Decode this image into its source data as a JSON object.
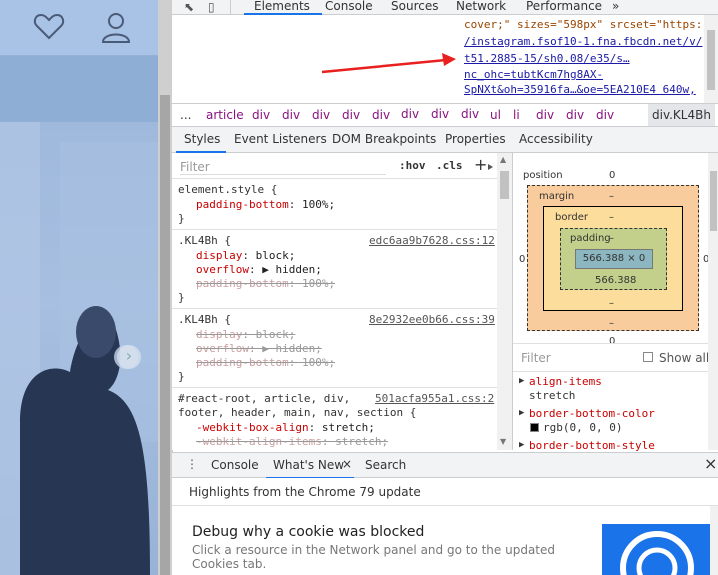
{
  "devtools_tabs": [
    "Elements",
    "Console",
    "Sources",
    "Network",
    "Performance",
    "»"
  ],
  "elements_code": [
    "cover;\" sizes=\"598px\" srcset=\"https:",
    "/instagram.fsof10-1.fna.fbcdn.net/v/",
    "t51.2885-15/sh0.08/e35/s…",
    "nc_ohc=tubtKcm7hg8AX-",
    "SpNXt&oh=35916fa…&oe=5EA210E4 640w,"
  ],
  "breadcrumbs": [
    "...",
    "article",
    "div",
    "div",
    "div",
    "div",
    "div",
    "ul",
    "li",
    "div",
    "div",
    "div",
    "div.KL4Bh"
  ],
  "sub_tabs": [
    "Styles",
    "Event Listeners",
    "DOM Breakpoints",
    "Properties",
    "Accessibility"
  ],
  "filter_placeholder": "Filter",
  "hov_label": ":hov",
  "cls_label": ".cls",
  "plus_label": "+",
  "rules": [
    {
      "selector": "element.style {",
      "source": "",
      "decls": [
        {
          "p": "padding-bottom",
          "v": "100%;",
          "struck": false
        }
      ]
    },
    {
      "selector": ".KL4Bh {",
      "source": "edc6aa9b7628.css:12",
      "decls": [
        {
          "p": "display",
          "v": "block;",
          "struck": false
        },
        {
          "p": "overflow",
          "v": "▶ hidden;",
          "struck": false
        },
        {
          "p": "padding-bottom",
          "v": "100%;",
          "struck": true
        }
      ]
    },
    {
      "selector": ".KL4Bh {",
      "source": "8e2932ee0b66.css:39",
      "decls": [
        {
          "p": "display",
          "v": "block;",
          "struck": true
        },
        {
          "p": "overflow",
          "v": "▶ hidden;",
          "struck": true
        },
        {
          "p": "padding-bottom",
          "v": "100%;",
          "struck": true
        }
      ]
    },
    {
      "selector": "#react-root, article, div,",
      "source": "501acfa955a1.css:2",
      "decls": []
    }
  ],
  "rule4_line2": "footer, header, main, nav, section {",
  "rule4_decls": [
    {
      "p": "-webkit-box-align",
      "v": "stretch;",
      "struck": false
    },
    {
      "p": "-webkit-align-items",
      "v": "stretch;",
      "struck": true
    }
  ],
  "close_brace": "}",
  "boxmodel": {
    "position_label": "position",
    "position_val": "0",
    "margin_label": "margin",
    "margin_val": "–",
    "border_label": "border",
    "border_val": "–",
    "padding_label": "padding",
    "padding_val": "–",
    "content": "566.388 × 0",
    "padding_bottom": "566.388",
    "left_outer": "0",
    "right_outer": "0",
    "dash": "–",
    "bottom_outer": "0"
  },
  "computed_filter": "Filter",
  "show_all": "Show all",
  "computed_props": [
    {
      "p": "align-items",
      "v": "stretch"
    },
    {
      "p": "border-bottom-color",
      "v": "rgb(0, 0, 0)"
    },
    {
      "p": "border-bottom-style",
      "v": ""
    }
  ],
  "drawer_tabs": [
    "Console",
    "What's New",
    "Search"
  ],
  "drawer_close": "×",
  "highlights": "Highlights from the Chrome 79 update",
  "debug_title": "Debug why a cookie was blocked",
  "debug_desc_1": "Click a resource in the Network panel and go to the updated",
  "debug_desc_2": "Cookies tab.",
  "colors": {
    "accent": "#1a73e8",
    "arrow": "#e8201e",
    "margin": "#f9cc9d",
    "border": "#fddd9b",
    "padding": "#c3d08b",
    "content": "#8cb6c0"
  }
}
